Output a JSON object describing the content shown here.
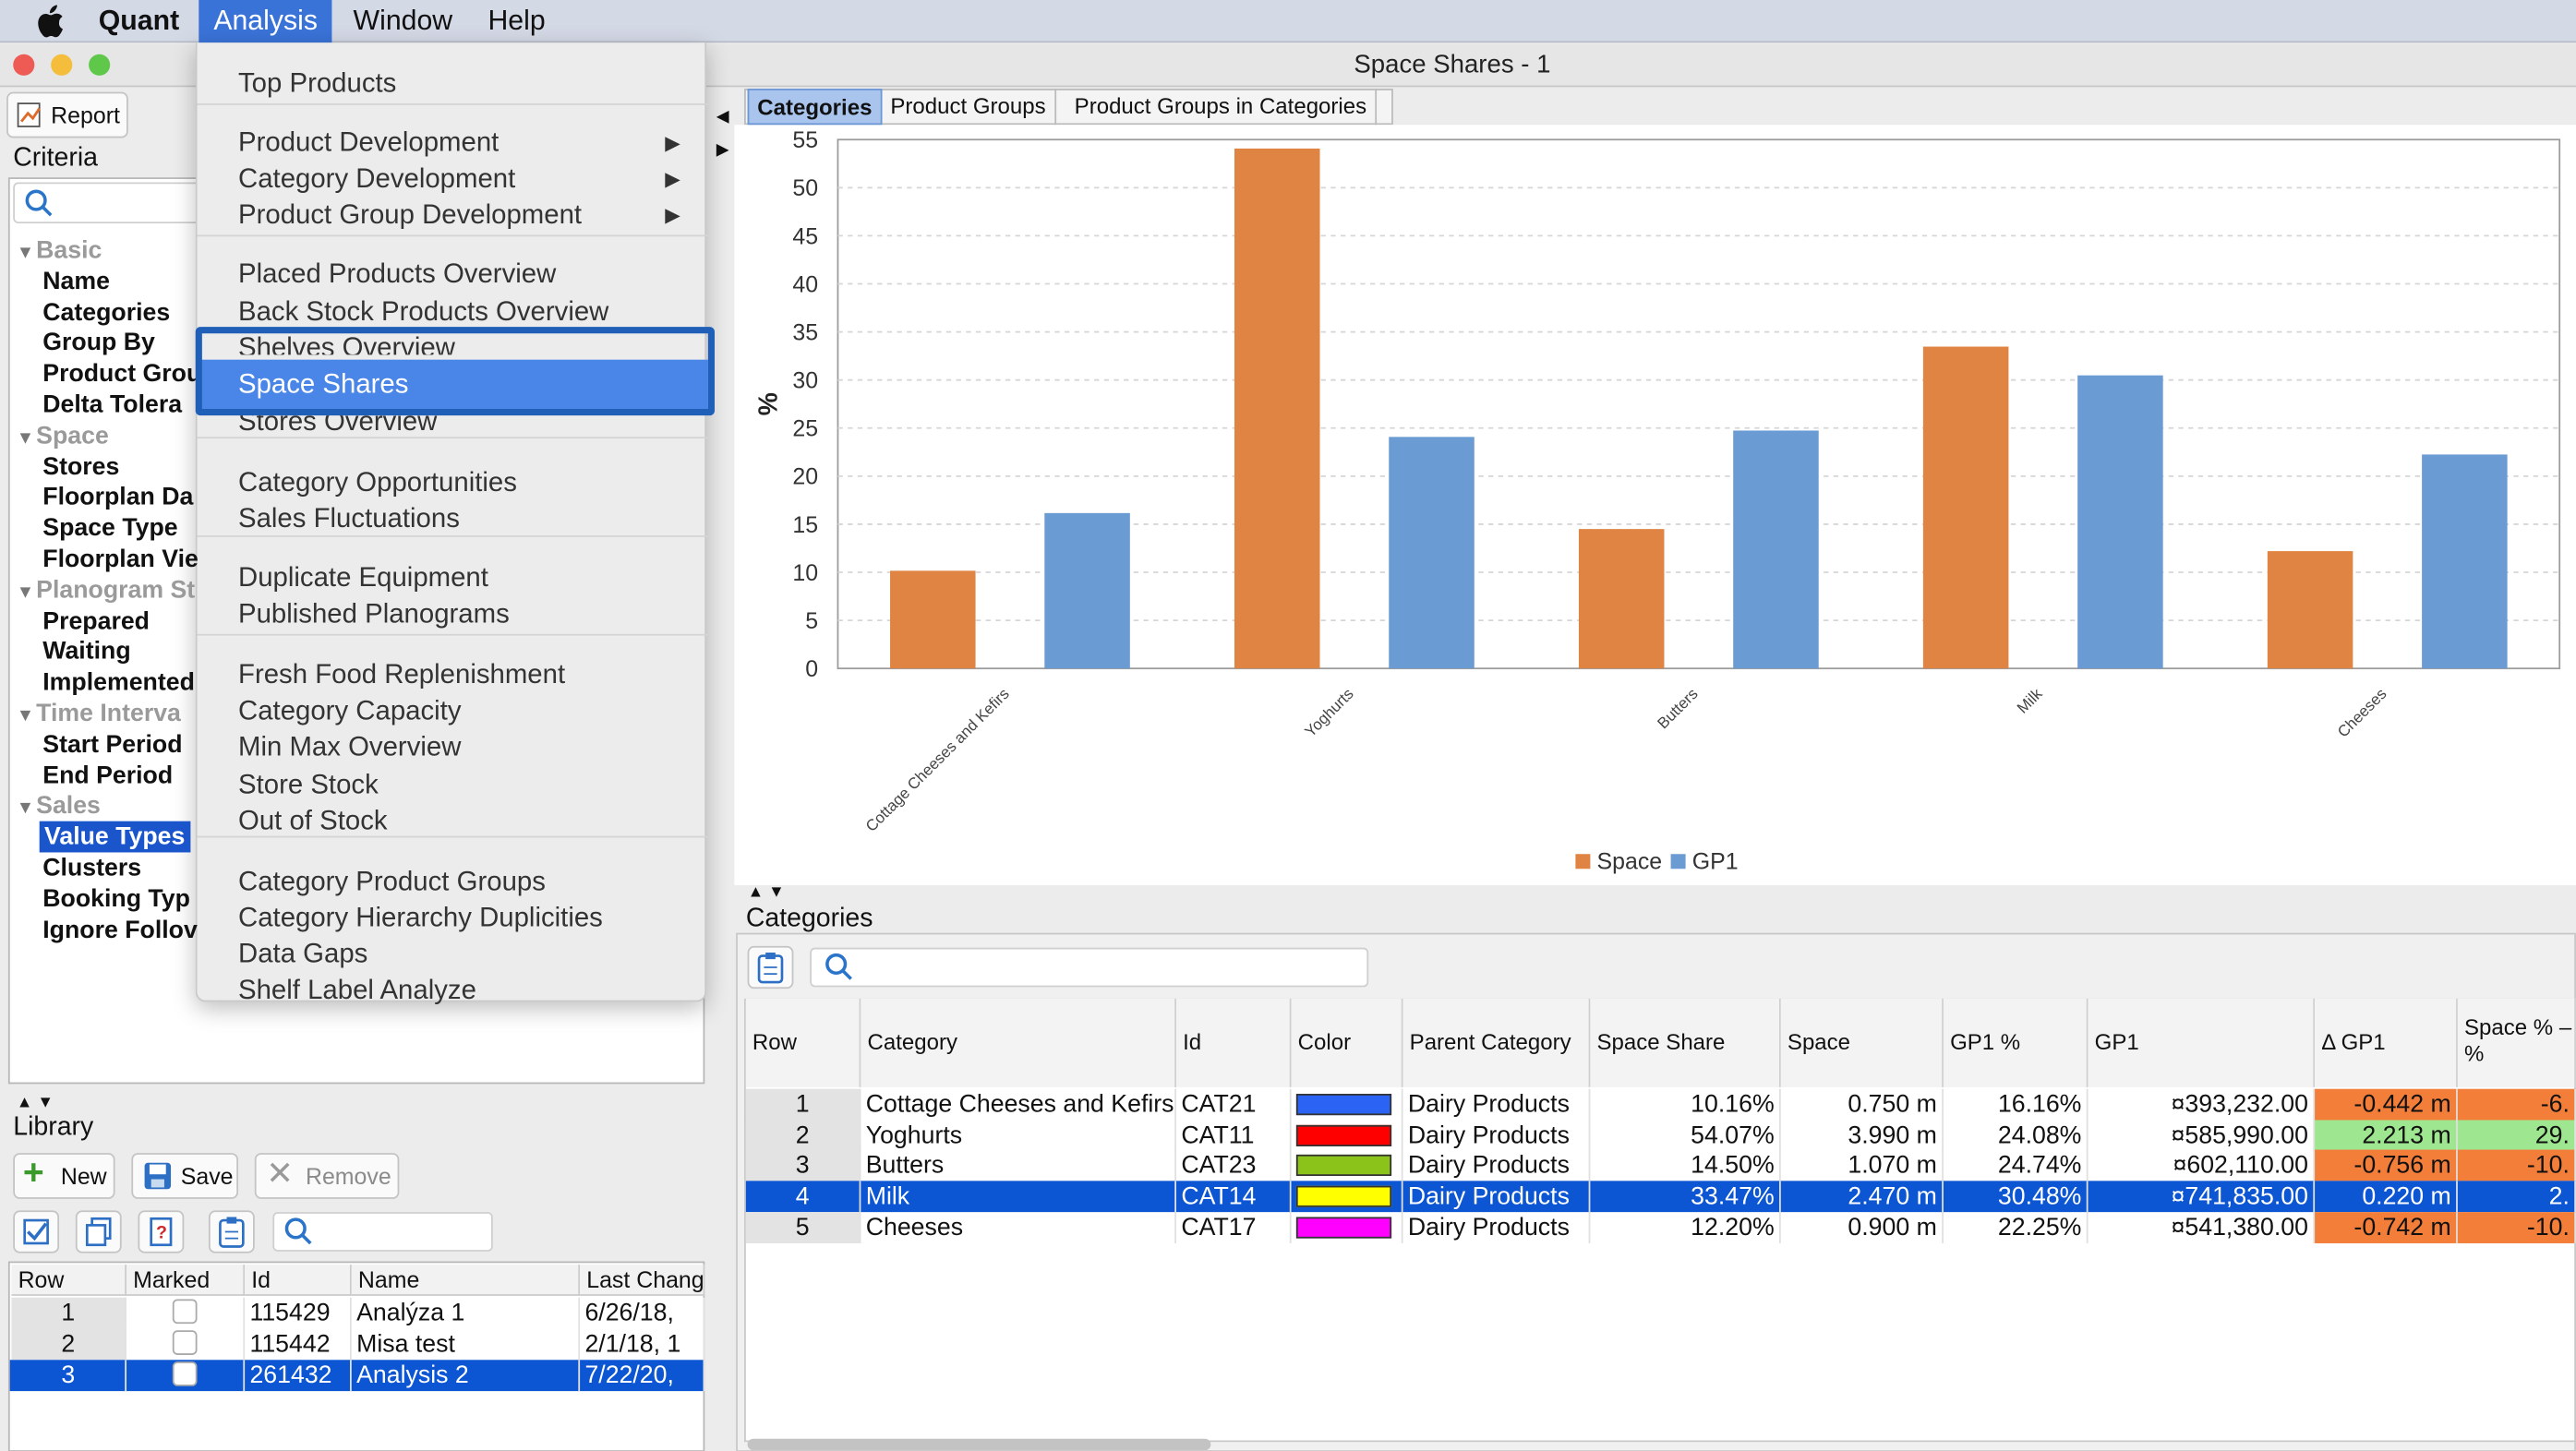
{
  "menubar": {
    "app": "Quant",
    "items": [
      "Analysis",
      "Window",
      "Help"
    ]
  },
  "window": {
    "title": "Space Shares - 1"
  },
  "toolbar": {
    "report_label": "Report"
  },
  "criteria": {
    "title": "Criteria",
    "groups": [
      {
        "label": "Basic",
        "items": [
          "Name",
          "Categories",
          "Group By",
          "Product Grou",
          "Delta Tolera"
        ]
      },
      {
        "label": "Space",
        "items": [
          "Stores",
          "Floorplan Da",
          "Space Type",
          "Floorplan Vie"
        ]
      },
      {
        "label": "Planogram St",
        "items": [
          "Prepared",
          "Waiting",
          "Implemented"
        ]
      },
      {
        "label": "Time Interva",
        "items": [
          "Start Period",
          "End Period"
        ]
      },
      {
        "label": "Sales",
        "items": [
          "Value Types",
          "Clusters",
          "Booking Typ",
          "Ignore Follov"
        ]
      }
    ],
    "selected": "Value Types"
  },
  "menu": {
    "items": [
      {
        "label": "Top Products"
      },
      {
        "label": "Product Development",
        "submenu": true
      },
      {
        "label": "Category Development",
        "submenu": true
      },
      {
        "label": "Product Group Development",
        "submenu": true
      },
      {
        "label": "Placed Products Overview"
      },
      {
        "label": "Back Stock Products Overview"
      },
      {
        "label": "Shelves Overview"
      },
      {
        "label": "Space Shares",
        "highlighted": true
      },
      {
        "label": "Stores Overview"
      },
      {
        "label": "Category Opportunities"
      },
      {
        "label": "Sales Fluctuations"
      },
      {
        "label": "Duplicate Equipment"
      },
      {
        "label": "Published Planograms"
      },
      {
        "label": "Fresh Food Replenishment"
      },
      {
        "label": "Category Capacity"
      },
      {
        "label": "Min Max Overview"
      },
      {
        "label": "Store Stock"
      },
      {
        "label": "Out of Stock"
      },
      {
        "label": "Category Product Groups"
      },
      {
        "label": "Category Hierarchy Duplicities"
      },
      {
        "label": "Data Gaps"
      },
      {
        "label": "Shelf Label Analyze"
      }
    ]
  },
  "tabs": [
    "Categories",
    "Product Groups",
    "Product Groups in Categories"
  ],
  "chart_data": {
    "type": "bar",
    "categories": [
      "Cottage Cheeses and Kefirs",
      "Yoghurts",
      "Butters",
      "Milk",
      "Cheeses"
    ],
    "series": [
      {
        "name": "Space",
        "values": [
          10.16,
          54.07,
          14.5,
          33.47,
          12.2
        ]
      },
      {
        "name": "GP1",
        "values": [
          16.16,
          24.08,
          24.74,
          30.48,
          22.25
        ]
      }
    ],
    "ylabel": "%",
    "ylim": [
      0,
      55
    ],
    "yticks": [
      0,
      5,
      10,
      15,
      20,
      25,
      30,
      35,
      40,
      45,
      50,
      55
    ],
    "grid": true,
    "legend": "bottom-center",
    "colors": {
      "Space": "#e08443",
      "GP1": "#6b9bd3"
    }
  },
  "categories_table": {
    "title": "Categories",
    "columns": [
      "Row",
      "Category",
      "Id",
      "Color",
      "Parent Category",
      "Space Share",
      "Space",
      "GP1 %",
      "GP1",
      "Δ GP1",
      "Space % – %"
    ],
    "rows": [
      {
        "row": "1",
        "category": "Cottage Cheeses and Kefirs",
        "id": "CAT21",
        "color": "#2b63f5",
        "parent": "Dairy Products",
        "share": "10.16%",
        "space": "0.750 m",
        "gp1p": "16.16%",
        "gp1": "¤393,232.00",
        "dgp1": "-0.442 m",
        "sp": "-6."
      },
      {
        "row": "2",
        "category": "Yoghurts",
        "id": "CAT11",
        "color": "#ff0000",
        "parent": "Dairy Products",
        "share": "54.07%",
        "space": "3.990 m",
        "gp1p": "24.08%",
        "gp1": "¤585,990.00",
        "dgp1": "2.213 m",
        "sp": "29."
      },
      {
        "row": "3",
        "category": "Butters",
        "id": "CAT23",
        "color": "#8cc31a",
        "parent": "Dairy Products",
        "share": "14.50%",
        "space": "1.070 m",
        "gp1p": "24.74%",
        "gp1": "¤602,110.00",
        "dgp1": "-0.756 m",
        "sp": "-10."
      },
      {
        "row": "4",
        "category": "Milk",
        "id": "CAT14",
        "color": "#ffff00",
        "parent": "Dairy Products",
        "share": "33.47%",
        "space": "2.470 m",
        "gp1p": "30.48%",
        "gp1": "¤741,835.00",
        "dgp1": "0.220 m",
        "sp": "2."
      },
      {
        "row": "5",
        "category": "Cheeses",
        "id": "CAT17",
        "color": "#ff00ff",
        "parent": "Dairy Products",
        "share": "12.20%",
        "space": "0.900 m",
        "gp1p": "22.25%",
        "gp1": "¤541,380.00",
        "dgp1": "-0.742 m",
        "sp": "-10."
      }
    ],
    "selected_row": "4"
  },
  "library": {
    "title": "Library",
    "new_label": "New",
    "save_label": "Save",
    "remove_label": "Remove",
    "columns": [
      "Row",
      "Marked",
      "Id",
      "Name",
      "Last Chang"
    ],
    "rows": [
      {
        "row": "1",
        "id": "115429",
        "name": "Analýza 1",
        "changed": "6/26/18,"
      },
      {
        "row": "2",
        "id": "115442",
        "name": "Misa test",
        "changed": "2/1/18, 1"
      },
      {
        "row": "3",
        "id": "261432",
        "name": "Analysis 2",
        "changed": "7/22/20,"
      }
    ]
  }
}
